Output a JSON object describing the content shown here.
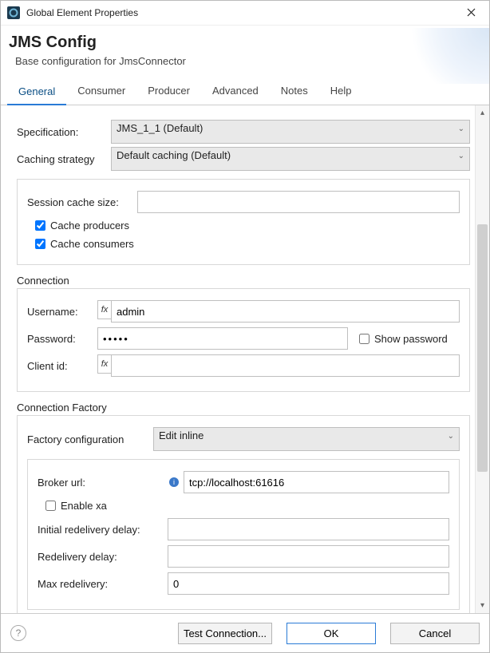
{
  "window": {
    "title": "Global Element Properties"
  },
  "header": {
    "title": "JMS Config",
    "subtitle": "Base configuration for JmsConnector"
  },
  "tabs": {
    "general": "General",
    "consumer": "Consumer",
    "producer": "Producer",
    "advanced": "Advanced",
    "notes": "Notes",
    "help": "Help"
  },
  "form": {
    "specification": {
      "label": "Specification:",
      "value": "JMS_1_1 (Default)"
    },
    "cachingStrategy": {
      "label": "Caching strategy",
      "value": "Default caching (Default)"
    },
    "sessionCacheSize": {
      "label": "Session cache size:",
      "value": ""
    },
    "cacheProducers": {
      "label": "Cache producers"
    },
    "cacheConsumers": {
      "label": "Cache consumers"
    },
    "connection": {
      "legend": "Connection",
      "username": {
        "label": "Username:",
        "value": "admin"
      },
      "password": {
        "label": "Password:",
        "value": "•••••"
      },
      "showPassword": {
        "label": "Show password"
      },
      "clientId": {
        "label": "Client id:",
        "value": ""
      }
    },
    "connectionFactory": {
      "legend": "Connection Factory",
      "factoryConfig": {
        "label": "Factory configuration",
        "value": "Edit inline"
      },
      "brokerUrl": {
        "label": "Broker url:",
        "value": "tcp://localhost:61616"
      },
      "enableXa": {
        "label": "Enable xa"
      },
      "initialRedelivery": {
        "label": "Initial redelivery delay:",
        "value": ""
      },
      "redeliveryDelay": {
        "label": "Redelivery delay:",
        "value": ""
      },
      "maxRedelivery": {
        "label": "Max redelivery:",
        "value": "0"
      }
    }
  },
  "footer": {
    "test": "Test Connection...",
    "ok": "OK",
    "cancel": "Cancel"
  }
}
